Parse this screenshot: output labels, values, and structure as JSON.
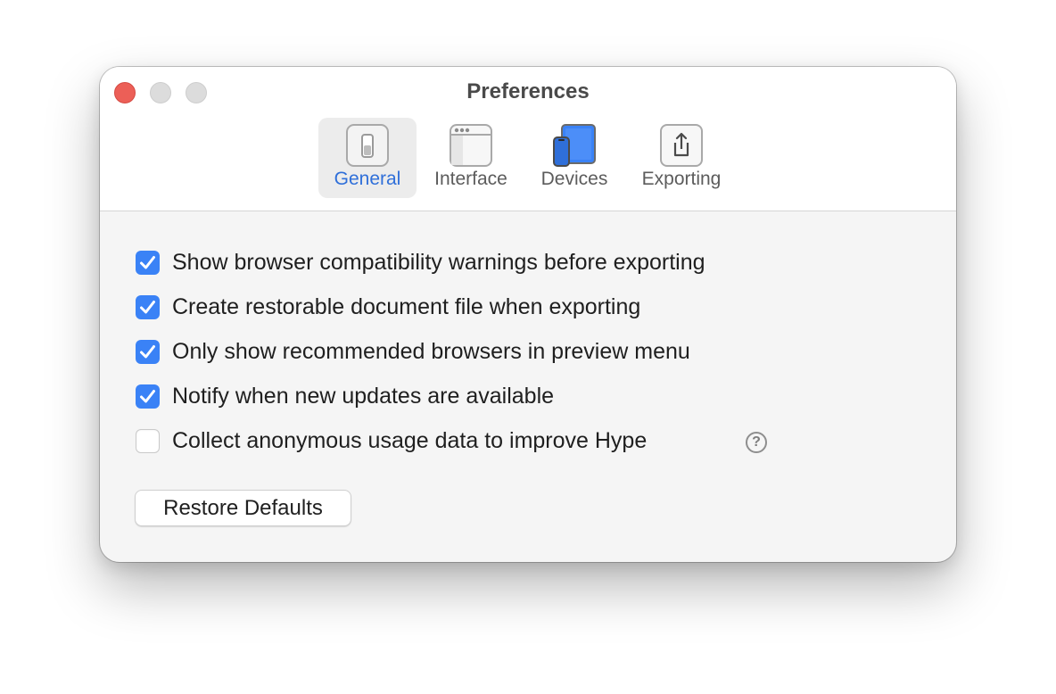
{
  "window": {
    "title": "Preferences"
  },
  "toolbar": {
    "tabs": [
      {
        "label": "General",
        "icon": "switch-icon",
        "selected": true
      },
      {
        "label": "Interface",
        "icon": "window-icon",
        "selected": false
      },
      {
        "label": "Devices",
        "icon": "devices-icon",
        "selected": false
      },
      {
        "label": "Exporting",
        "icon": "share-icon",
        "selected": false
      }
    ]
  },
  "options": [
    {
      "label": "Show browser compatibility warnings before exporting",
      "checked": true
    },
    {
      "label": "Create restorable document file when exporting",
      "checked": true
    },
    {
      "label": "Only show recommended browsers in preview menu",
      "checked": true
    },
    {
      "label": "Notify when new updates are available",
      "checked": true
    },
    {
      "label": "Collect anonymous usage data to improve Hype",
      "checked": false
    }
  ],
  "help_glyph": "?",
  "restore_button": {
    "label": "Restore Defaults"
  },
  "colors": {
    "accent": "#3a82f6",
    "selected_label": "#2f6fd9",
    "close_button": "#ec5f57"
  }
}
